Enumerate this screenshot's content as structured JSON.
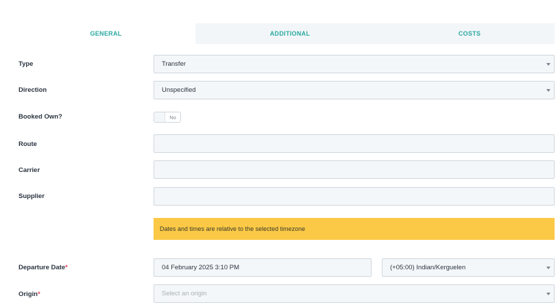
{
  "tabs": [
    {
      "label": "GENERAL"
    },
    {
      "label": "ADDITIONAL"
    },
    {
      "label": "COSTS"
    }
  ],
  "form": {
    "type": {
      "label": "Type",
      "value": "Transfer"
    },
    "direction": {
      "label": "Direction",
      "value": "Unspecified"
    },
    "booked_own": {
      "label": "Booked Own?",
      "toggle_text": "No",
      "checked": false
    },
    "route": {
      "label": "Route",
      "value": ""
    },
    "carrier": {
      "label": "Carrier",
      "value": ""
    },
    "supplier": {
      "label": "Supplier",
      "value": ""
    },
    "notice": "Dates and times are relative to the selected timezone",
    "departure_date": {
      "label": "Departure Date",
      "required_mark": "*",
      "value": "04 February 2025 3:10 PM",
      "timezone": "(+05:00) Indian/Kerguelen"
    },
    "origin": {
      "label": "Origin",
      "required_mark": "*",
      "placeholder": "Select an origin"
    }
  },
  "colors": {
    "accent": "#2aa8a0",
    "notice": "#fbc946",
    "required": "#e0455f",
    "field_bg": "#f4f7f9"
  }
}
